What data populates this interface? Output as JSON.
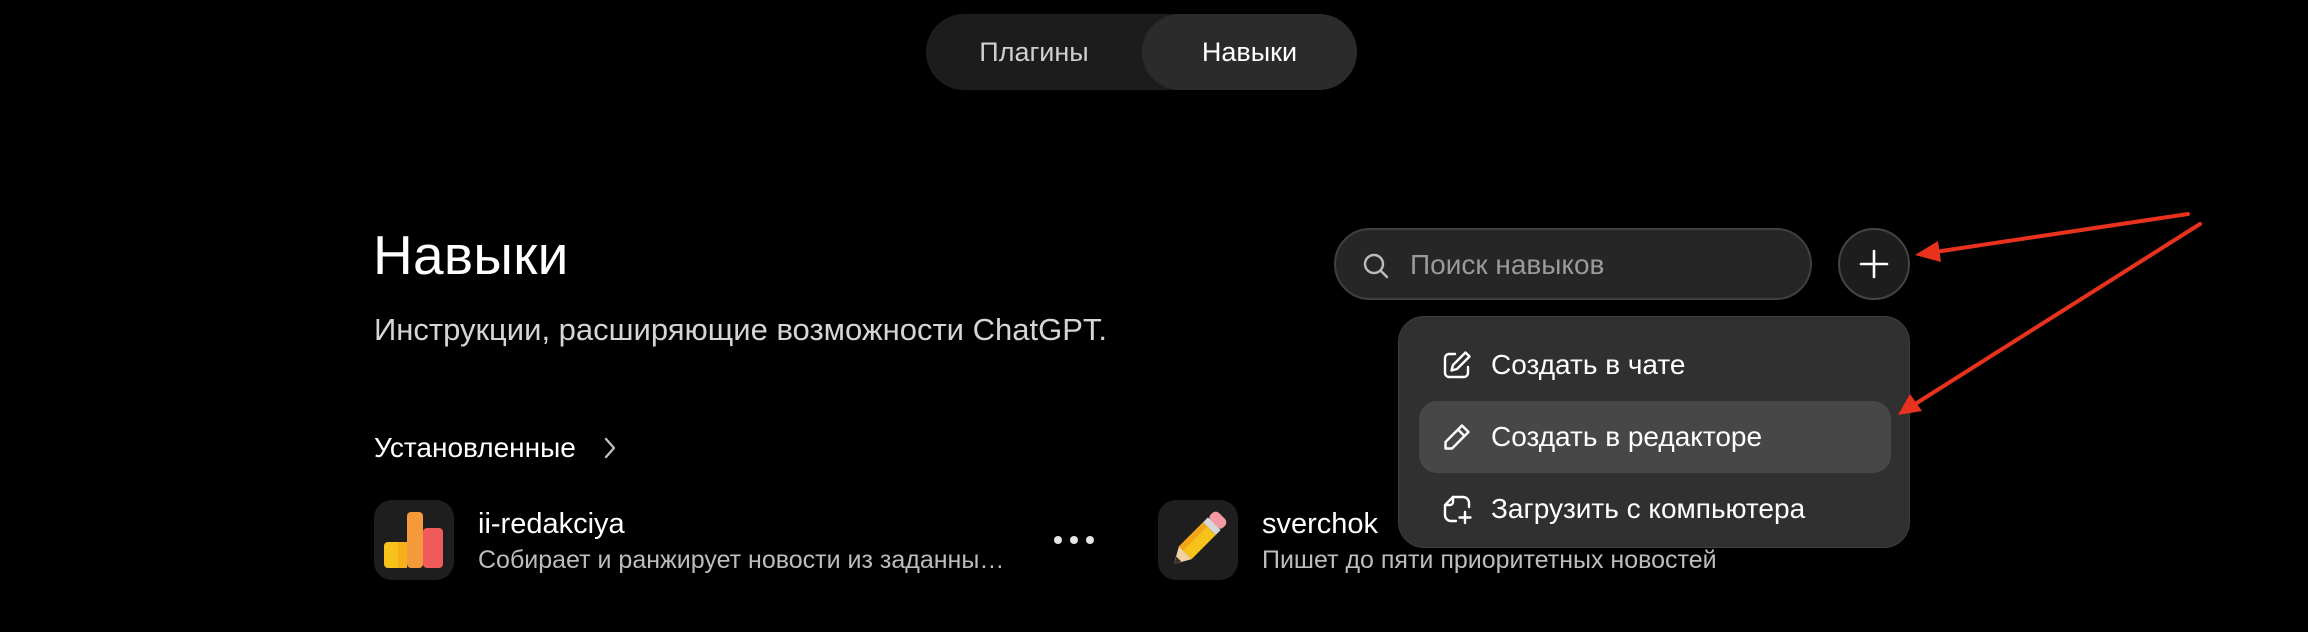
{
  "tabs": [
    {
      "label": "Плагины",
      "active": false
    },
    {
      "label": "Навыки",
      "active": true
    }
  ],
  "header": {
    "title": "Навыки",
    "subtitle": "Инструкции, расширяющие возможности ChatGPT."
  },
  "search": {
    "placeholder": "Поиск навыков",
    "value": "",
    "icon": "search-icon"
  },
  "add_button": {
    "icon": "plus-icon"
  },
  "create_menu": {
    "items": [
      {
        "label": "Создать в чате",
        "icon": "edit-square-icon",
        "highlighted": false
      },
      {
        "label": "Создать в редакторе",
        "icon": "pencil-icon",
        "highlighted": true
      },
      {
        "label": "Загрузить с компьютера",
        "icon": "upload-file-icon",
        "highlighted": false
      }
    ]
  },
  "installed": {
    "title": "Установленные",
    "items": [
      {
        "name": "ii-redakciya",
        "description": "Собирает и ранжирует новости из заданны…",
        "icon": "bar-chart-icon"
      },
      {
        "name": "sverchok",
        "description": "Пишет до пяти приоритетных новостей",
        "icon": "pencil-icon"
      }
    ]
  },
  "colors": {
    "background": "#000000",
    "menu": "#303030",
    "menu_highlight": "#474747",
    "annotation_arrow": "#e8321e",
    "bar_yellow": "#f7c31a",
    "bar_orange": "#f59a3c",
    "bar_red": "#ef5a5a"
  }
}
